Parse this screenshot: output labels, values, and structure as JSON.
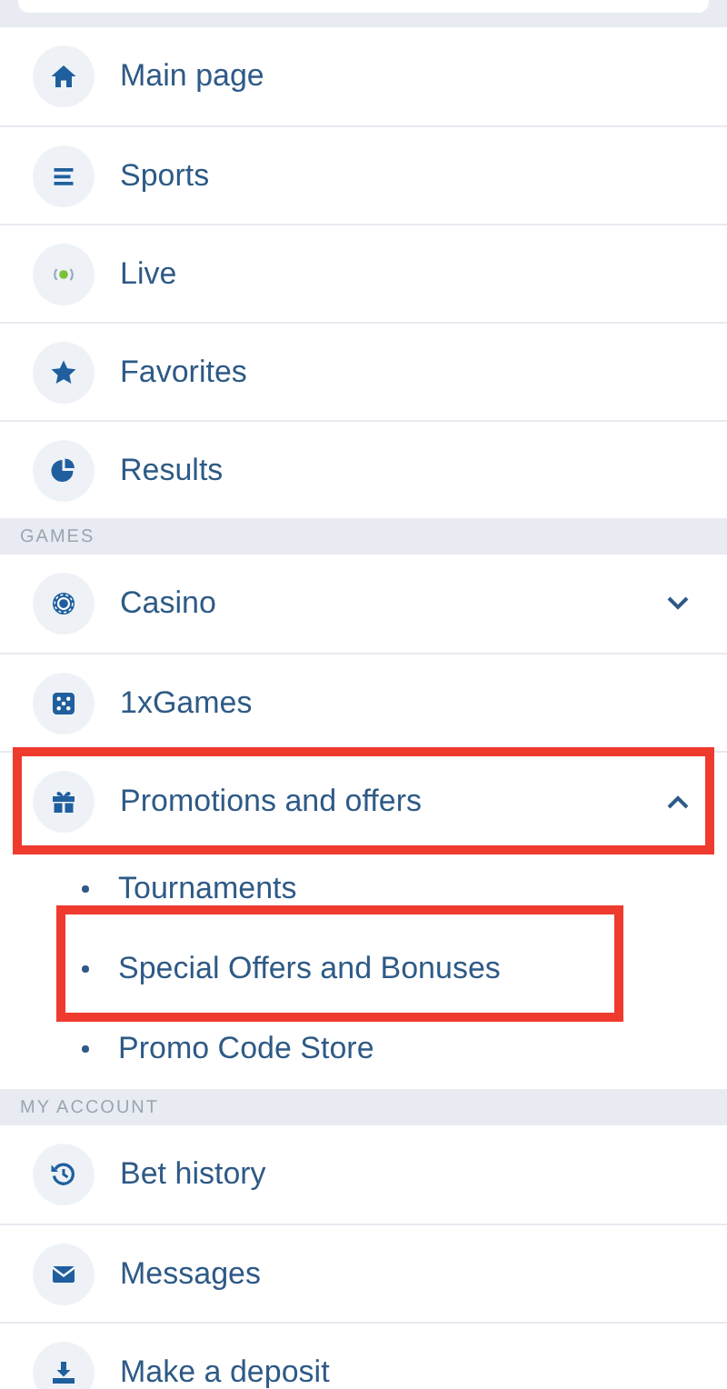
{
  "sections": [
    {
      "items": [
        {
          "label": "Main page",
          "highlighted": false
        },
        {
          "label": "Sports",
          "highlighted": false
        },
        {
          "label": "Live",
          "highlighted": false
        },
        {
          "label": "Favorites",
          "highlighted": false
        },
        {
          "label": "Results",
          "highlighted": false
        }
      ]
    },
    {
      "heading": "GAMES",
      "items": [
        {
          "label": "Casino",
          "highlighted": false,
          "expanded": false
        },
        {
          "label": "1xGames",
          "highlighted": false
        },
        {
          "label": "Promotions and offers",
          "highlighted": true,
          "expanded": true,
          "children": [
            {
              "label": "Tournaments",
              "highlighted": false
            },
            {
              "label": "Special Offers and Bonuses",
              "highlighted": true
            },
            {
              "label": "Promo Code Store",
              "highlighted": false
            }
          ]
        }
      ]
    },
    {
      "heading": "MY ACCOUNT",
      "items": [
        {
          "label": "Bet history",
          "highlighted": false
        },
        {
          "label": "Messages",
          "highlighted": false
        },
        {
          "label": "Make a deposit",
          "highlighted": false
        }
      ]
    }
  ]
}
